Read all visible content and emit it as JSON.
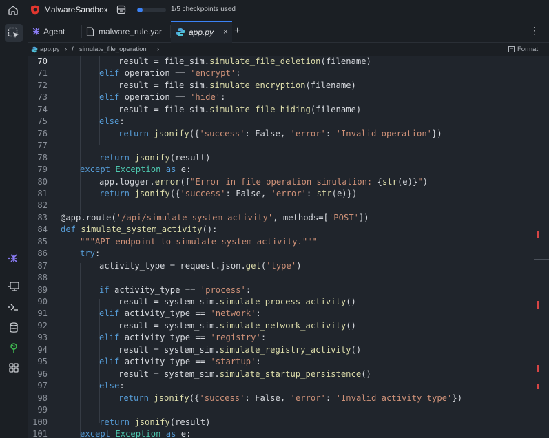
{
  "app": {
    "name": "MalwareSandbox",
    "progress_text": "1/5 checkpoints used",
    "progress_fraction": 0.2
  },
  "tabs": [
    {
      "label": "Agent",
      "icon": "agent-icon"
    },
    {
      "label": "malware_rule.yar",
      "icon": "file-icon"
    },
    {
      "label": "app.py",
      "icon": "python-icon",
      "active": true
    }
  ],
  "breadcrumb": {
    "file": "app.py",
    "symbol": "simulate_file_operation",
    "format_label": "Format"
  },
  "editor": {
    "current_line": 70,
    "lines": [
      {
        "n": 70,
        "indent": 3,
        "t": [
          [
            "",
            "result = file_sim."
          ],
          [
            "fn",
            "simulate_file_deletion"
          ],
          [
            "",
            "(filename)"
          ]
        ]
      },
      {
        "n": 71,
        "indent": 2,
        "t": [
          [
            "kw",
            "elif"
          ],
          [
            "",
            " operation == "
          ],
          [
            "st",
            "'encrypt'"
          ],
          [
            "",
            ":"
          ]
        ]
      },
      {
        "n": 72,
        "indent": 3,
        "t": [
          [
            "",
            "result = file_sim."
          ],
          [
            "fn",
            "simulate_encryption"
          ],
          [
            "",
            "(filename)"
          ]
        ]
      },
      {
        "n": 73,
        "indent": 2,
        "t": [
          [
            "kw",
            "elif"
          ],
          [
            "",
            " operation == "
          ],
          [
            "st",
            "'hide'"
          ],
          [
            "",
            ":"
          ]
        ]
      },
      {
        "n": 74,
        "indent": 3,
        "t": [
          [
            "",
            "result = file_sim."
          ],
          [
            "fn",
            "simulate_file_hiding"
          ],
          [
            "",
            "(filename)"
          ]
        ]
      },
      {
        "n": 75,
        "indent": 2,
        "t": [
          [
            "kw",
            "else"
          ],
          [
            "",
            ":"
          ]
        ]
      },
      {
        "n": 76,
        "indent": 3,
        "t": [
          [
            "kw",
            "return"
          ],
          [
            "",
            " "
          ],
          [
            "fn",
            "jsonify"
          ],
          [
            "",
            "({"
          ],
          [
            "st",
            "'success'"
          ],
          [
            "",
            ": False, "
          ],
          [
            "st",
            "'error'"
          ],
          [
            "",
            ": "
          ],
          [
            "st",
            "'Invalid operation'"
          ],
          [
            "",
            "})"
          ]
        ]
      },
      {
        "n": 77,
        "indent": 0,
        "t": []
      },
      {
        "n": 78,
        "indent": 2,
        "t": [
          [
            "kw",
            "return"
          ],
          [
            "",
            " "
          ],
          [
            "fn",
            "jsonify"
          ],
          [
            "",
            "(result)"
          ]
        ]
      },
      {
        "n": 79,
        "indent": 1,
        "t": [
          [
            "kw",
            "except"
          ],
          [
            "",
            " "
          ],
          [
            "cl",
            "Exception"
          ],
          [
            "",
            " "
          ],
          [
            "kw",
            "as"
          ],
          [
            "",
            " e:"
          ]
        ]
      },
      {
        "n": 80,
        "indent": 2,
        "t": [
          [
            "",
            "app.logger."
          ],
          [
            "fn",
            "error"
          ],
          [
            "",
            "(f"
          ],
          [
            "st",
            "\"Error in file operation simulation: "
          ],
          [
            "",
            "{"
          ],
          [
            "fn",
            "str"
          ],
          [
            "",
            "(e)}"
          ],
          [
            "st",
            "\""
          ],
          [
            "",
            ")"
          ]
        ]
      },
      {
        "n": 81,
        "indent": 2,
        "t": [
          [
            "kw",
            "return"
          ],
          [
            "",
            " "
          ],
          [
            "fn",
            "jsonify"
          ],
          [
            "",
            "({"
          ],
          [
            "st",
            "'success'"
          ],
          [
            "",
            ": False, "
          ],
          [
            "st",
            "'error'"
          ],
          [
            "",
            ": "
          ],
          [
            "fn",
            "str"
          ],
          [
            "",
            "(e)})"
          ]
        ]
      },
      {
        "n": 82,
        "indent": 0,
        "t": []
      },
      {
        "n": 83,
        "indent": 0,
        "t": [
          [
            "",
            "@app.route("
          ],
          [
            "st",
            "'/api/simulate-system-activity'"
          ],
          [
            "",
            ", methods=["
          ],
          [
            "st",
            "'POST'"
          ],
          [
            "",
            "])"
          ]
        ]
      },
      {
        "n": 84,
        "indent": 0,
        "t": [
          [
            "kw",
            "def"
          ],
          [
            "",
            " "
          ],
          [
            "fn",
            "simulate_system_activity"
          ],
          [
            "",
            "():"
          ]
        ]
      },
      {
        "n": 85,
        "indent": 1,
        "t": [
          [
            "st",
            "\"\"\"API endpoint to simulate system activity.\"\"\""
          ]
        ]
      },
      {
        "n": 86,
        "indent": 1,
        "t": [
          [
            "kw",
            "try"
          ],
          [
            "",
            ":"
          ]
        ]
      },
      {
        "n": 87,
        "indent": 2,
        "t": [
          [
            "",
            "activity_type = request.json."
          ],
          [
            "fn",
            "get"
          ],
          [
            "",
            "("
          ],
          [
            "st",
            "'type'"
          ],
          [
            "",
            ")"
          ]
        ]
      },
      {
        "n": 88,
        "indent": 0,
        "t": []
      },
      {
        "n": 89,
        "indent": 2,
        "t": [
          [
            "kw",
            "if"
          ],
          [
            "",
            " activity_type == "
          ],
          [
            "st",
            "'process'"
          ],
          [
            "",
            ":"
          ]
        ]
      },
      {
        "n": 90,
        "indent": 3,
        "t": [
          [
            "",
            "result = system_sim."
          ],
          [
            "fn",
            "simulate_process_activity"
          ],
          [
            "",
            "()"
          ]
        ]
      },
      {
        "n": 91,
        "indent": 2,
        "t": [
          [
            "kw",
            "elif"
          ],
          [
            "",
            " activity_type == "
          ],
          [
            "st",
            "'network'"
          ],
          [
            "",
            ":"
          ]
        ]
      },
      {
        "n": 92,
        "indent": 3,
        "t": [
          [
            "",
            "result = system_sim."
          ],
          [
            "fn",
            "simulate_network_activity"
          ],
          [
            "",
            "()"
          ]
        ]
      },
      {
        "n": 93,
        "indent": 2,
        "t": [
          [
            "kw",
            "elif"
          ],
          [
            "",
            " activity_type == "
          ],
          [
            "st",
            "'registry'"
          ],
          [
            "",
            ":"
          ]
        ]
      },
      {
        "n": 94,
        "indent": 3,
        "t": [
          [
            "",
            "result = system_sim."
          ],
          [
            "fn",
            "simulate_registry_activity"
          ],
          [
            "",
            "()"
          ]
        ]
      },
      {
        "n": 95,
        "indent": 2,
        "t": [
          [
            "kw",
            "elif"
          ],
          [
            "",
            " activity_type == "
          ],
          [
            "st",
            "'startup'"
          ],
          [
            "",
            ":"
          ]
        ]
      },
      {
        "n": 96,
        "indent": 3,
        "t": [
          [
            "",
            "result = system_sim."
          ],
          [
            "fn",
            "simulate_startup_persistence"
          ],
          [
            "",
            "()"
          ]
        ]
      },
      {
        "n": 97,
        "indent": 2,
        "t": [
          [
            "kw",
            "else"
          ],
          [
            "",
            ":"
          ]
        ]
      },
      {
        "n": 98,
        "indent": 3,
        "t": [
          [
            "kw",
            "return"
          ],
          [
            "",
            " "
          ],
          [
            "fn",
            "jsonify"
          ],
          [
            "",
            "({"
          ],
          [
            "st",
            "'success'"
          ],
          [
            "",
            ": False, "
          ],
          [
            "st",
            "'error'"
          ],
          [
            "",
            ": "
          ],
          [
            "st",
            "'Invalid activity type'"
          ],
          [
            "",
            "})"
          ]
        ]
      },
      {
        "n": 99,
        "indent": 0,
        "t": []
      },
      {
        "n": 100,
        "indent": 2,
        "t": [
          [
            "kw",
            "return"
          ],
          [
            "",
            " "
          ],
          [
            "fn",
            "jsonify"
          ],
          [
            "",
            "(result)"
          ]
        ]
      },
      {
        "n": 101,
        "indent": 1,
        "t": [
          [
            "kw",
            "except"
          ],
          [
            "",
            " "
          ],
          [
            "cl",
            "Exception"
          ],
          [
            "",
            " "
          ],
          [
            "kw",
            "as"
          ],
          [
            "",
            " e:"
          ]
        ]
      }
    ]
  },
  "colors": {
    "accent": "#3b82f6",
    "keyword": "#569cd6",
    "function": "#dcdcaa",
    "string": "#ce9178",
    "error_mark": "#d64545"
  }
}
